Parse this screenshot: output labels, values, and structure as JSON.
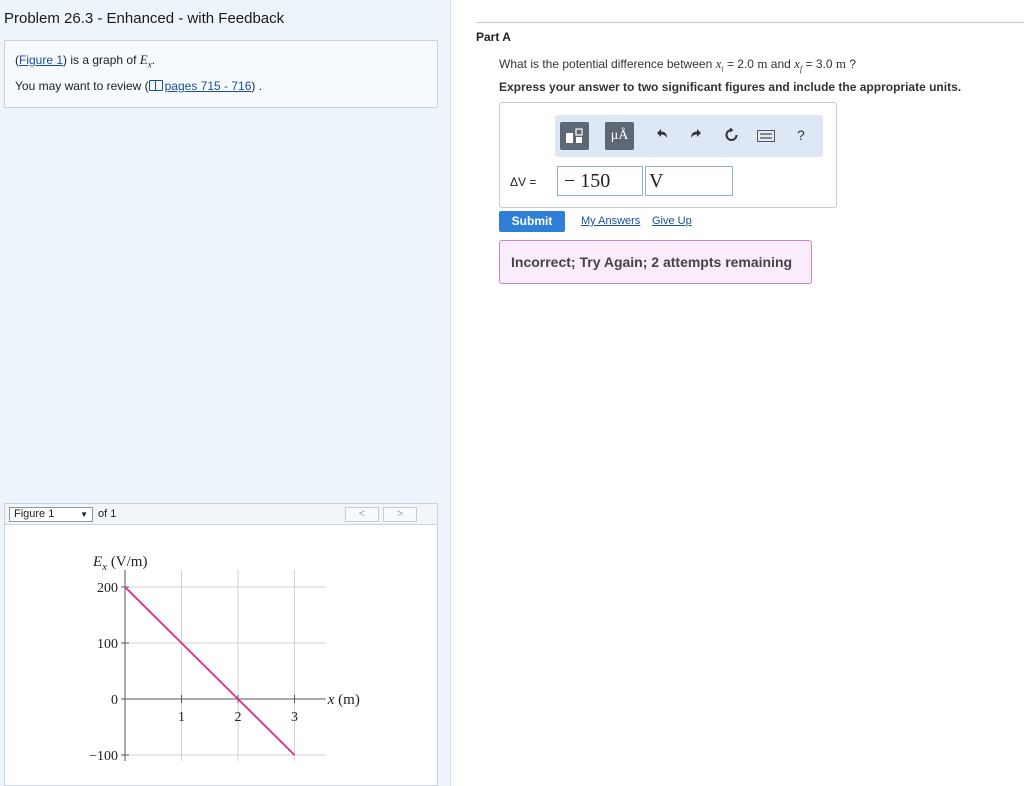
{
  "problem": {
    "title": "Problem 26.3 - Enhanced - with Feedback"
  },
  "intro": {
    "figure_link": "Figure 1",
    "graph_of_text": ") is a graph of ",
    "field_symbol": "E",
    "field_subscript": "x",
    "review_prefix": "You may want to review (",
    "pages_link": "pages 715 - 716",
    "review_suffix": ") ."
  },
  "figure_nav": {
    "selected": "Figure 1",
    "of_text": "of 1",
    "prev_label": "<",
    "next_label": ">"
  },
  "chart_data": {
    "type": "line",
    "ylabel": "E_x (V/m)",
    "xlabel": "x (m)",
    "x_ticks": [
      1,
      2,
      3
    ],
    "y_ticks": [
      200,
      100,
      0,
      -100
    ],
    "y_tick_labels": [
      "200",
      "100",
      "0",
      "−100"
    ],
    "xlim": [
      0,
      3.5
    ],
    "ylim": [
      -100,
      200
    ],
    "grid": true,
    "series": [
      {
        "x": [
          0,
          3
        ],
        "y": [
          200,
          -100
        ],
        "color": "#e0278a"
      }
    ]
  },
  "part": {
    "title": "Part A",
    "question": {
      "prefix": "What is the potential difference between ",
      "xi_symbol": "x",
      "xi_sub": "i",
      "xi_value": " = 2.0 ",
      "xi_unit": "m",
      "mid": " and ",
      "xf_symbol": "x",
      "xf_sub": "f",
      "xf_value": " = 3.0 ",
      "xf_unit": "m",
      "suffix": " ?"
    },
    "instructions": "Express your answer to two significant figures and include the appropriate units."
  },
  "toolbar": {
    "units_label": "μÅ",
    "help_label": "?"
  },
  "answer": {
    "label": "ΔV =",
    "value": "− 150",
    "unit": "V"
  },
  "actions": {
    "submit": "Submit",
    "my_answers": "My Answers",
    "give_up": "Give Up"
  },
  "feedback": {
    "message": "Incorrect; Try Again; 2 attempts remaining",
    "colors": {
      "background": "#fbecfb",
      "border": "#c487c8"
    }
  },
  "colors": {
    "accent": "#2f7fd8",
    "link": "#1a4f9c",
    "plot_line": "#e0278a"
  }
}
